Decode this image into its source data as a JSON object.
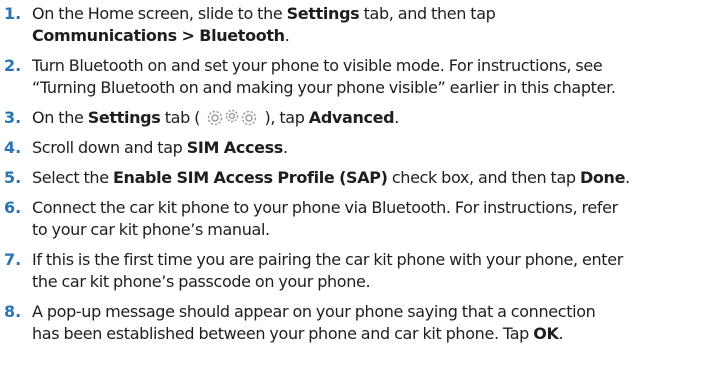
{
  "steps": [
    {
      "num": "1.",
      "parts": [
        {
          "t": "On the Home screen, slide to the "
        },
        {
          "t": "Settings",
          "b": true
        },
        {
          "t": " tab, and then tap "
        },
        {
          "br": true
        },
        {
          "t": "Communications > Bluetooth",
          "b": true
        },
        {
          "t": "."
        }
      ]
    },
    {
      "num": "2.",
      "parts": [
        {
          "t": "Turn Bluetooth on and set your phone to visible mode. For instructions, see "
        },
        {
          "br": true
        },
        {
          "t": "“Turning Bluetooth on and making your phone visible” earlier in this chapter."
        }
      ]
    },
    {
      "num": "3.",
      "parts": [
        {
          "t": "On the "
        },
        {
          "t": "Settings",
          "b": true
        },
        {
          "t": " tab ( "
        },
        {
          "icon": "settings-gears-icon"
        },
        {
          "t": " ), tap "
        },
        {
          "t": "Advanced",
          "b": true
        },
        {
          "t": "."
        }
      ]
    },
    {
      "num": "4.",
      "parts": [
        {
          "t": "Scroll down and tap "
        },
        {
          "t": "SIM Access",
          "b": true
        },
        {
          "t": "."
        }
      ]
    },
    {
      "num": "5.",
      "parts": [
        {
          "t": "Select the "
        },
        {
          "t": "Enable SIM Access Profile (SAP)",
          "b": true
        },
        {
          "t": " check box, and then tap "
        },
        {
          "t": "Done",
          "b": true
        },
        {
          "t": "."
        }
      ]
    },
    {
      "num": "6.",
      "parts": [
        {
          "t": "Connect the car kit phone to your phone via Bluetooth. For instructions, refer "
        },
        {
          "br": true
        },
        {
          "t": "to your car kit phone’s manual."
        }
      ]
    },
    {
      "num": "7.",
      "parts": [
        {
          "t": "If this is the first time you are pairing the car kit phone with your phone, enter "
        },
        {
          "br": true
        },
        {
          "t": "the car kit phone’s passcode on your phone."
        }
      ]
    },
    {
      "num": "8.",
      "parts": [
        {
          "t": "A pop-up message should appear on your phone saying that a connection "
        },
        {
          "br": true
        },
        {
          "t": "has been established between your phone and car kit phone. Tap "
        },
        {
          "t": "OK",
          "b": true
        },
        {
          "t": "."
        }
      ]
    }
  ]
}
